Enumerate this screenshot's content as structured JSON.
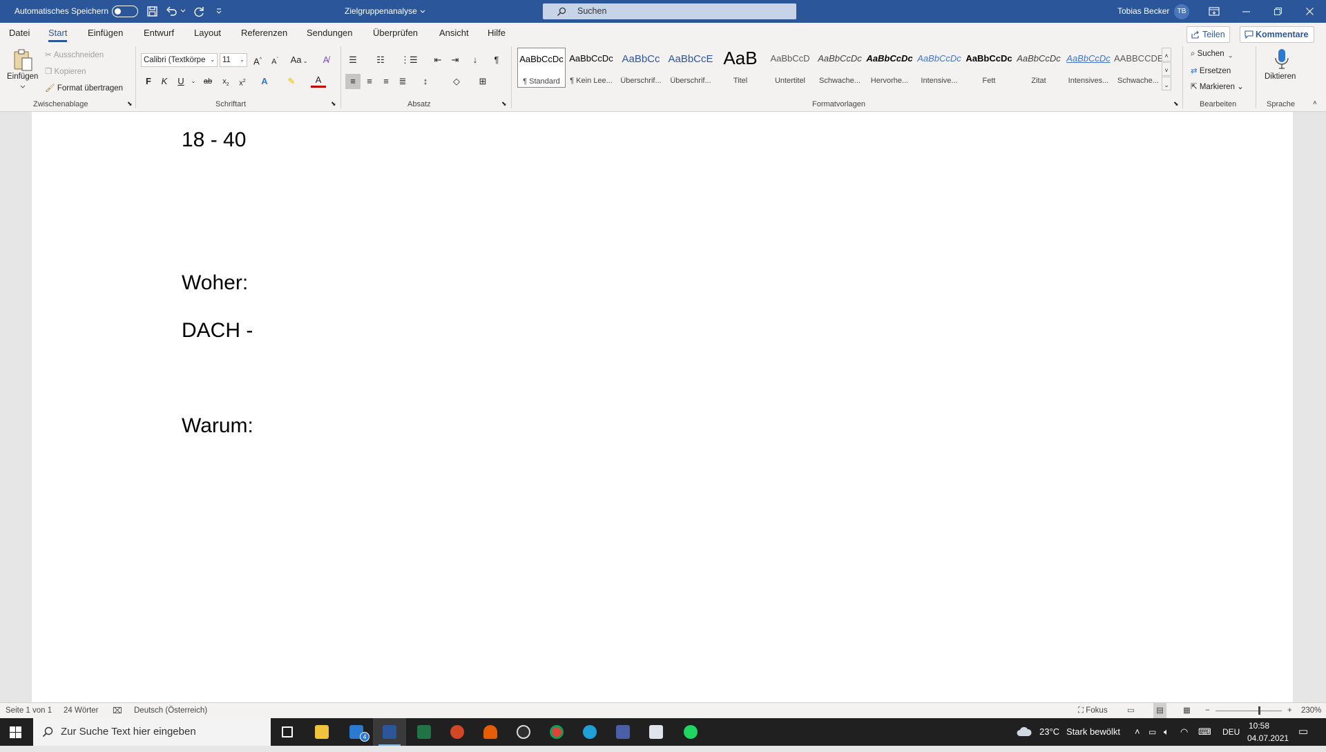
{
  "titlebar": {
    "autosave_label": "Automatisches Speichern",
    "doc_title": "Zielgruppenanalyse",
    "search_label": "Suchen",
    "user_name": "Tobias Becker",
    "user_initials": "TB"
  },
  "tabs": [
    "Datei",
    "Start",
    "Einfügen",
    "Entwurf",
    "Layout",
    "Referenzen",
    "Sendungen",
    "Überprüfen",
    "Ansicht",
    "Hilfe"
  ],
  "actions": {
    "share": "Teilen",
    "comments": "Kommentare"
  },
  "clipboard": {
    "paste": "Einfügen",
    "cut": "Ausschneiden",
    "copy": "Kopieren",
    "format_painter": "Format übertragen",
    "group": "Zwischenablage"
  },
  "font": {
    "name": "Calibri (Textkörpe",
    "size": "11",
    "aa_label": "Aa",
    "group": "Schriftart"
  },
  "paragraph": {
    "group": "Absatz"
  },
  "styles": {
    "items": [
      {
        "preview": "AaBbCcDc",
        "name": "¶ Standard",
        "color": "#000000"
      },
      {
        "preview": "AaBbCcDc",
        "name": "¶ Kein Lee...",
        "color": "#000000"
      },
      {
        "preview": "AaBbCc",
        "name": "Überschrif...",
        "color": "#2f5496"
      },
      {
        "preview": "AaBbCcE",
        "name": "Überschrif...",
        "color": "#2f5496"
      },
      {
        "preview": "AaB",
        "name": "Titel",
        "color": "#000000"
      },
      {
        "preview": "AaBbCcD",
        "name": "Untertitel",
        "color": "#595959"
      },
      {
        "preview": "AaBbCcDc",
        "name": "Schwache...",
        "color": "#404040"
      },
      {
        "preview": "AaBbCcDc",
        "name": "Hervorhe...",
        "color": "#000000"
      },
      {
        "preview": "AaBbCcDc",
        "name": "Intensive...",
        "color": "#4472c4"
      },
      {
        "preview": "AaBbCcDc",
        "name": "Fett",
        "color": "#000000"
      },
      {
        "preview": "AaBbCcDc",
        "name": "Zitat",
        "color": "#404040"
      },
      {
        "preview": "AaBbCcDc",
        "name": "Intensives...",
        "color": "#4472c4"
      },
      {
        "preview": "AABBCCDE",
        "name": "Schwache...",
        "color": "#595959"
      }
    ],
    "group": "Formatvorlagen"
  },
  "editing": {
    "find": "Suchen",
    "replace": "Ersetzen",
    "select": "Markieren",
    "group": "Bearbeiten"
  },
  "voice": {
    "dictate": "Diktieren",
    "group": "Sprache"
  },
  "document": {
    "lines": [
      "18 - 40",
      "Woher:",
      "DACH -",
      "Warum:"
    ]
  },
  "status": {
    "page": "Seite 1 von 1",
    "words": "24 Wörter",
    "language": "Deutsch (Österreich)",
    "focus": "Fokus",
    "zoom": "230%"
  },
  "taskbar": {
    "search_placeholder": "Zur Suche Text hier eingeben",
    "mail_badge": "4",
    "weather_temp": "23°C",
    "weather_text": "Stark bewölkt",
    "lang": "DEU",
    "time": "10:58",
    "date": "04.07.2021"
  }
}
